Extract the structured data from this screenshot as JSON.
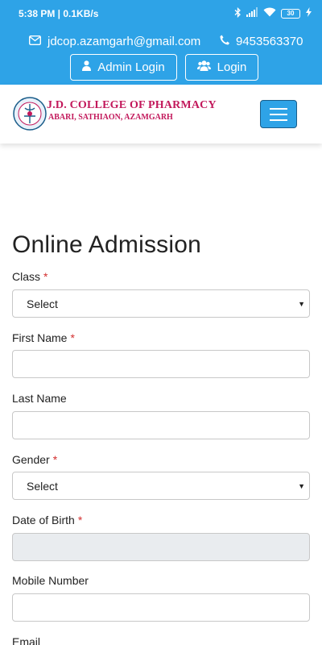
{
  "status_bar": {
    "time_speed": "5:38 PM | 0.1KB/s",
    "battery": "30"
  },
  "top_bar": {
    "email": "jdcop.azamgarh@gmail.com",
    "phone": "9453563370",
    "admin_login_label": "Admin Login",
    "login_label": "Login"
  },
  "header": {
    "brand_title": "J.D. COLLEGE OF PHARMACY",
    "brand_subtitle": "ABARI, SATHIAON, AZAMGARH"
  },
  "form": {
    "title": "Online Admission",
    "required_mark": "*",
    "fields": {
      "class": {
        "label": "Class",
        "value": "Select"
      },
      "first_name": {
        "label": "First Name",
        "value": ""
      },
      "last_name": {
        "label": "Last Name",
        "value": ""
      },
      "gender": {
        "label": "Gender",
        "value": "Select"
      },
      "dob": {
        "label": "Date of Birth",
        "value": ""
      },
      "mobile": {
        "label": "Mobile Number",
        "value": ""
      },
      "email": {
        "label": "Email"
      }
    }
  },
  "colors": {
    "brand_blue": "#2ea3e7",
    "brand_magenta": "#c2185b",
    "required_red": "#d32f2f"
  },
  "icons": [
    "bluetooth-icon",
    "signal-icon",
    "wifi-icon",
    "battery-icon",
    "charging-icon",
    "envelope-icon",
    "phone-icon",
    "user-icon",
    "users-icon",
    "hamburger-menu-icon",
    "caret-down-icon"
  ]
}
